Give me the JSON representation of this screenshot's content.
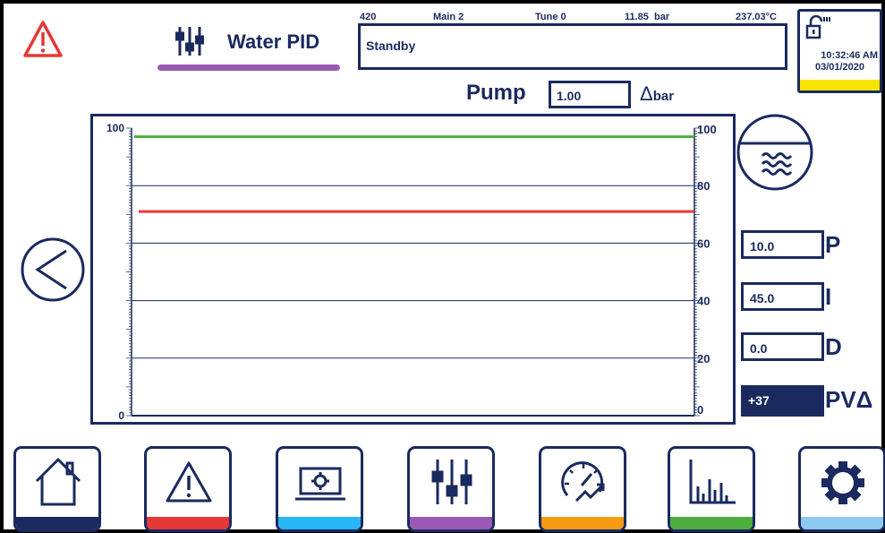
{
  "header": {
    "title": "Water PID",
    "status_row": {
      "id": "420",
      "main": "Main 2",
      "tune": "Tune 0",
      "pressure": "11.85  bar",
      "temperature": "237.03°C"
    },
    "status_message": "Standby",
    "clock": {
      "time": "10:32:46 AM",
      "date": "03/01/2020"
    }
  },
  "pump": {
    "label": "Pump",
    "value": "1.00",
    "unit_symbol": "Δ",
    "unit": "bar"
  },
  "pid": {
    "p_value": "10.0",
    "p_label": "P",
    "i_value": "45.0",
    "i_label": "I",
    "d_value": "0.0",
    "d_label": "D",
    "pv_value": "+37",
    "pv_label": "PVΔ"
  },
  "chart_data": {
    "type": "line",
    "ylim": [
      0,
      100
    ],
    "left_ticks": [
      "100",
      "0"
    ],
    "right_ticks": [
      "100",
      "80",
      "60",
      "40",
      "20",
      "0"
    ],
    "series": [
      {
        "color": "#4caf3d",
        "values": [
          97,
          97
        ]
      },
      {
        "color": "#e53935",
        "values": [
          71,
          71
        ]
      }
    ]
  },
  "colors": {
    "navy": "#1a2a5e",
    "warning_red": "#e53935",
    "pid_purple": "#9b59b6",
    "lock_yellow": "#f7e400"
  },
  "nav": [
    {
      "name": "home",
      "icon": "home-icon",
      "bar_color": "#1a2a5e"
    },
    {
      "name": "alarms",
      "icon": "warning-icon",
      "bar_color": "#e53935"
    },
    {
      "name": "system",
      "icon": "laptop-gear-icon",
      "bar_color": "#29b6f6"
    },
    {
      "name": "pid",
      "icon": "sliders-icon",
      "bar_color": "#9b59b6"
    },
    {
      "name": "tuning",
      "icon": "gauge-trend-icon",
      "bar_color": "#f39c12"
    },
    {
      "name": "charts",
      "icon": "bar-chart-icon",
      "bar_color": "#4caf3d"
    },
    {
      "name": "settings",
      "icon": "gear-icon",
      "bar_color": "#8ec9f0"
    }
  ]
}
